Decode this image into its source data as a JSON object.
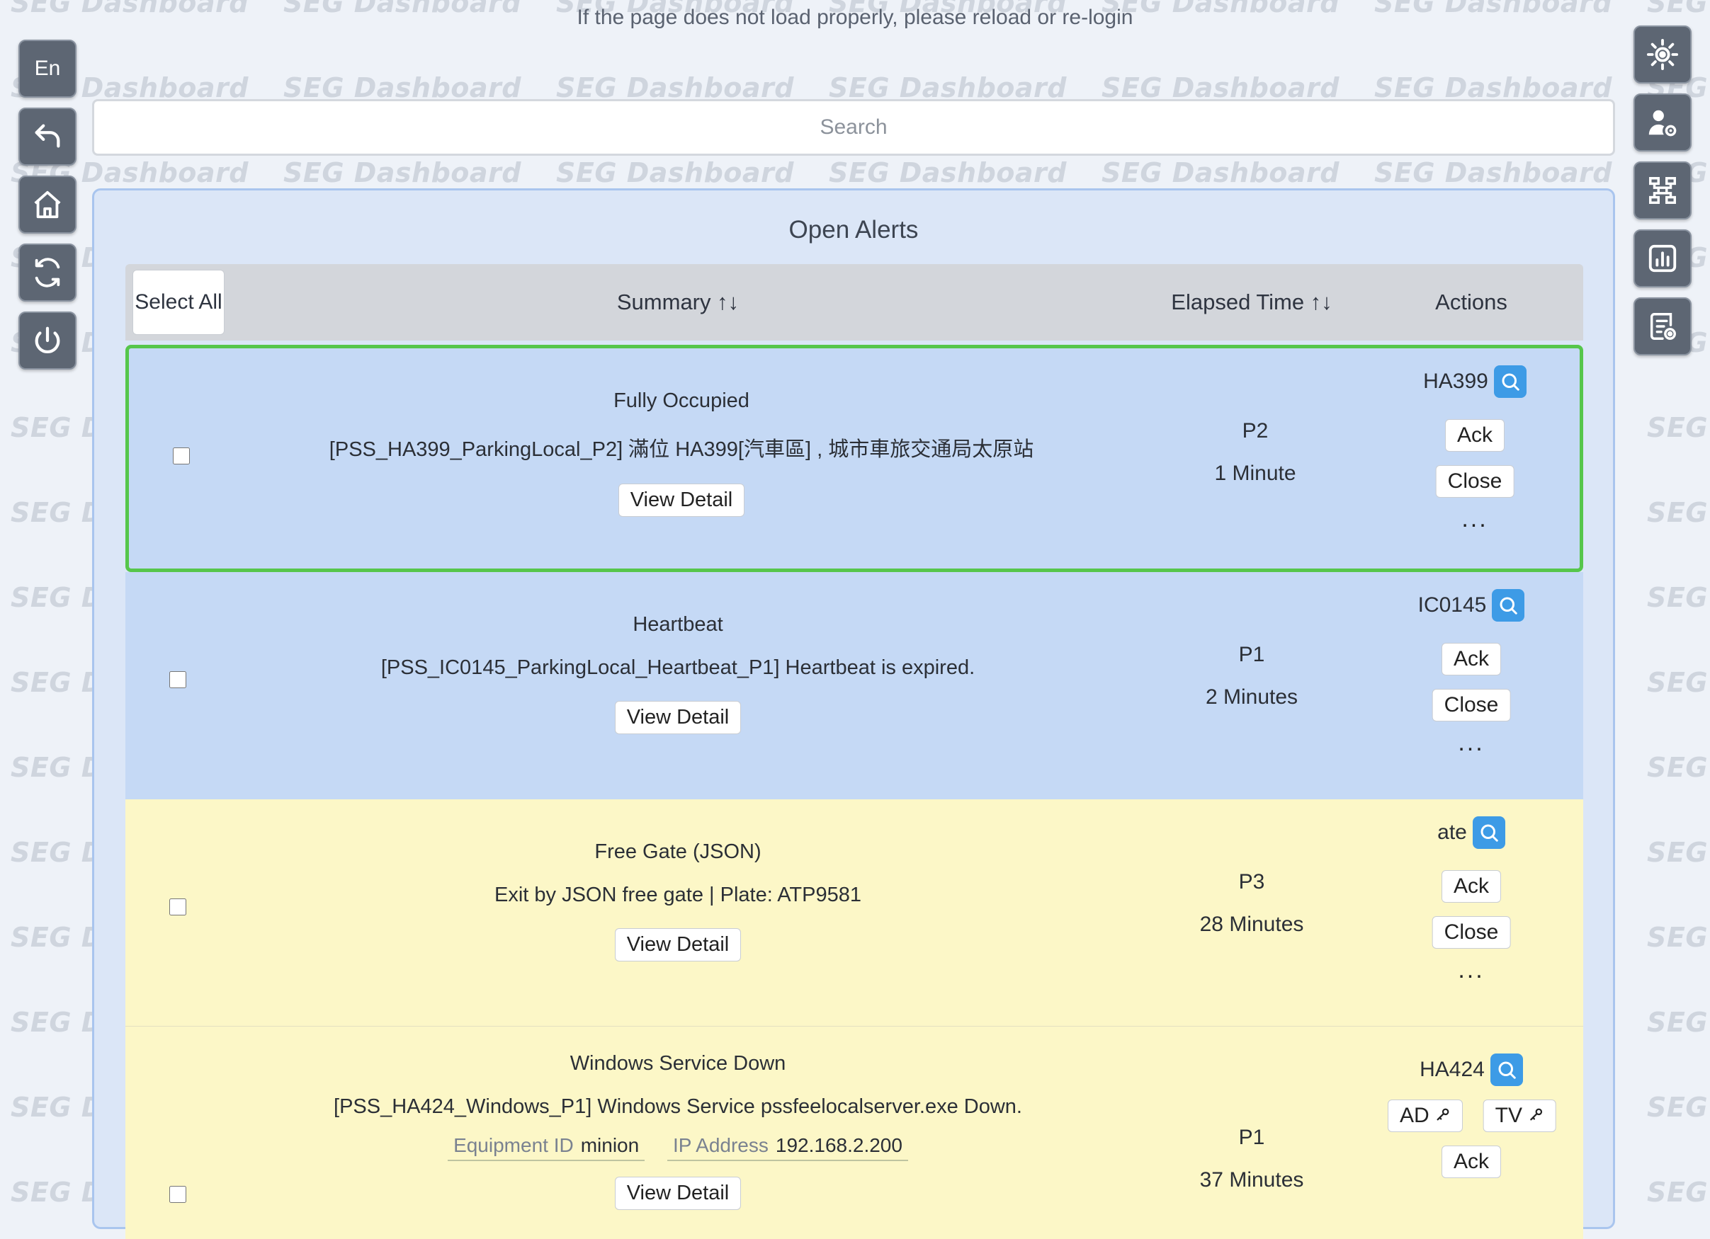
{
  "watermark": "SEG Dashboard",
  "notice": "If the page does not load properly, please reload or re-login",
  "left_toolbar": {
    "language": "En",
    "buttons": [
      "back-icon",
      "home-icon",
      "refresh-icon",
      "power-icon"
    ]
  },
  "right_toolbar": {
    "buttons": [
      "sun-gear-icon",
      "user-settings-icon",
      "network-icon",
      "report-chart-icon",
      "log-settings-icon"
    ]
  },
  "search": {
    "placeholder": "Search",
    "value": ""
  },
  "panel": {
    "title": "Open Alerts",
    "columns": {
      "select_all": "Select All",
      "summary": "Summary ↑↓",
      "elapsed": "Elapsed Time ↑↓",
      "actions": "Actions"
    }
  },
  "colors": {
    "blue_row": "#c5d9f5",
    "yellow_row": "#fcf7c7",
    "selected_border": "#56c64b",
    "accent": "#3d9be6"
  },
  "alerts": [
    {
      "title": "Fully Occupied",
      "description": "[PSS_HA399_ParkingLocal_P2] 滿位 HA399[汽車區] , 城市車旅交通局太原站",
      "view_detail": "View Detail",
      "priority": "P2",
      "elapsed": "1 Minute",
      "device": "HA399",
      "ack": "Ack",
      "close": "Close",
      "more": "...",
      "color": "blue",
      "selected": true
    },
    {
      "title": "Heartbeat",
      "description": "[PSS_IC0145_ParkingLocal_Heartbeat_P1] Heartbeat is expired.",
      "view_detail": "View Detail",
      "priority": "P1",
      "elapsed": "2 Minutes",
      "device": "IC0145",
      "ack": "Ack",
      "close": "Close",
      "more": "...",
      "color": "blue",
      "selected": false
    },
    {
      "title": "Free Gate (JSON)",
      "description": "Exit by JSON free gate | Plate: ATP9581",
      "view_detail": "View Detail",
      "priority": "P3",
      "elapsed": "28 Minutes",
      "device": "ate",
      "ack": "Ack",
      "close": "Close",
      "more": "...",
      "color": "yellow",
      "selected": false
    },
    {
      "title": "Windows Service Down",
      "description": "[PSS_HA424_Windows_P1] Windows Service pssfeelocalserver.exe Down.",
      "equipment_label": "Equipment ID",
      "equipment_value": "minion",
      "ip_label": "IP Address",
      "ip_value": "192.168.2.200",
      "view_detail": "View Detail",
      "priority": "P1",
      "elapsed": "37 Minutes",
      "device": "HA424",
      "remote_ad": "AD",
      "remote_tv": "TV",
      "ack": "Ack",
      "color": "yellow",
      "selected": false
    }
  ]
}
